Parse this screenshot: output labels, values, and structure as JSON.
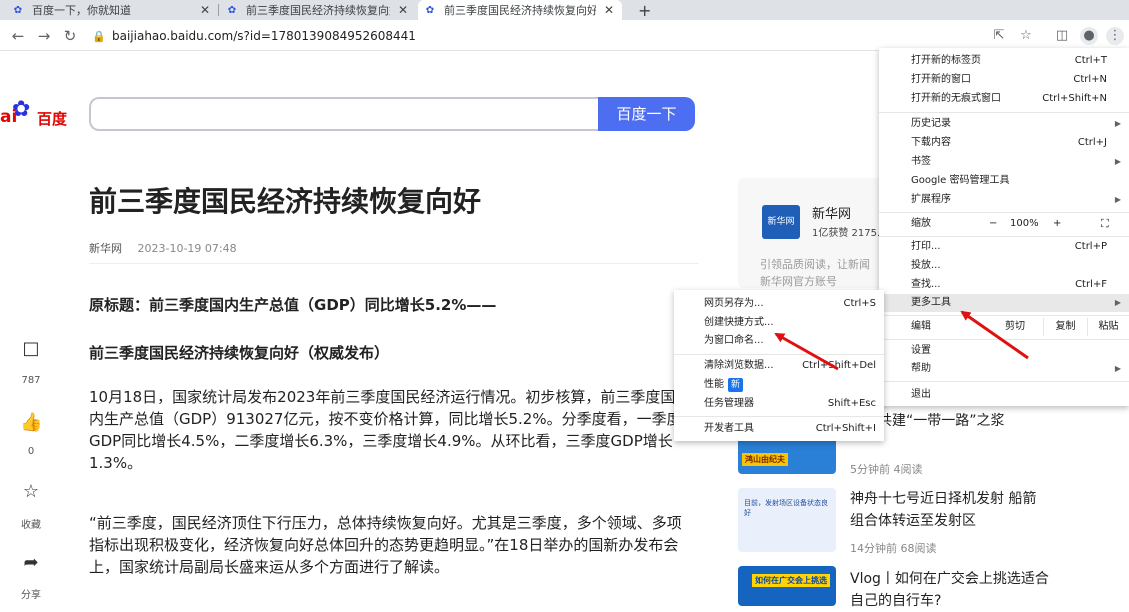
{
  "tabs": [
    {
      "title": "百度一下，你就知道",
      "active": false
    },
    {
      "title": "前三季度国民经济持续恢复向好",
      "active": false
    },
    {
      "title": "前三季度国民经济持续恢复向好",
      "active": true
    }
  ],
  "new_tab": "+",
  "address": {
    "url": "baijiahao.baidu.com/s?id=1780139084952608441"
  },
  "baidu": {
    "logo_bai": "ai",
    "logo_du": "百度",
    "search_button": "百度一下",
    "search_value": ""
  },
  "article": {
    "title": "前三季度国民经济持续恢复向好",
    "source": "新华网",
    "date": "2023-10-19 07:48",
    "paragraphs": [
      "原标题：前三季度国内生产总值（GDP）同比增长5.2%——",
      "前三季度国民经济持续恢复向好（权威发布）",
      "10月18日，国家统计局发布2023年前三季度国民经济运行情况。初步核算，前三季度国内生产总值（GDP）913027亿元，按不变价格计算，同比增长5.2%。分季度看，一季度GDP同比增长4.5%，二季度增长6.3%，三季度增长4.9%。从环比看，三季度GDP增长1.3%。",
      "“前三季度，国民经济顶住下行压力，总体持续恢复向好。尤其是三季度，多个领域、多项指标出现积极变化，经济恢复向好总体回升的态势更趋明显。”在18日举办的国新办发布会上，国家统计局副局长盛来运从多个方面进行了解读。"
    ]
  },
  "side": {
    "comments": "787",
    "likes": "0",
    "fav": "收藏",
    "share": "分享"
  },
  "author": {
    "name": "新华网",
    "stats": "1亿获赞 2175.",
    "desc1": "引领品质阅读，让新闻",
    "desc2": "新华网官方账号",
    "avatar_text": "新华网"
  },
  "news": [
    {
      "title": "共谋共建“一带一路”之浆",
      "meta": "5分钟前  4阅读",
      "thumb_text": "鸿山由纪夫"
    },
    {
      "title": "神舟十七号近日择机发射 船箭组合体转运至发射区",
      "meta": "14分钟前  68阅读",
      "thumb_text": "目前，发射场区设备状态良好"
    },
    {
      "title": "Vlog丨如何在广交会上挑选适合自己的自行车?",
      "meta": "",
      "thumb_text": "如何在广交会上挑选"
    }
  ],
  "menu": {
    "new_tab": {
      "label": "打开新的标签页",
      "shortcut": "Ctrl+T"
    },
    "new_window": {
      "label": "打开新的窗口",
      "shortcut": "Ctrl+N"
    },
    "incognito": {
      "label": "打开新的无痕式窗口",
      "shortcut": "Ctrl+Shift+N"
    },
    "history": {
      "label": "历史记录"
    },
    "downloads": {
      "label": "下载内容",
      "shortcut": "Ctrl+J"
    },
    "bookmarks": {
      "label": "书签"
    },
    "password": {
      "label": "Google 密码管理工具"
    },
    "extensions": {
      "label": "扩展程序"
    },
    "zoom": {
      "label": "缩放",
      "minus": "−",
      "value": "100%",
      "plus": "+"
    },
    "print": {
      "label": "打印...",
      "shortcut": "Ctrl+P"
    },
    "cast": {
      "label": "投放..."
    },
    "find": {
      "label": "查找...",
      "shortcut": "Ctrl+F"
    },
    "more_tools": {
      "label": "更多工具"
    },
    "edit": {
      "label": "编辑",
      "cut": "剪切",
      "copy": "复制",
      "paste": "粘贴"
    },
    "settings": {
      "label": "设置"
    },
    "help": {
      "label": "帮助"
    },
    "exit": {
      "label": "退出"
    }
  },
  "submenu": {
    "save_page": {
      "label": "网页另存为...",
      "shortcut": "Ctrl+S"
    },
    "shortcut": {
      "label": "创建快捷方式..."
    },
    "name_window": {
      "label": "为窗口命名..."
    },
    "clear_data": {
      "label": "清除浏览数据...",
      "shortcut": "Ctrl+Shift+Del"
    },
    "performance": {
      "label": "性能",
      "badge": "新"
    },
    "task_manager": {
      "label": "任务管理器",
      "shortcut": "Shift+Esc"
    },
    "devtools": {
      "label": "开发者工具",
      "shortcut": "Ctrl+Shift+I"
    }
  },
  "colors": {
    "baidu_blue": "#4e6ef2",
    "annotation_red": "#e01010",
    "menu_highlight": "#e8e8e8"
  }
}
